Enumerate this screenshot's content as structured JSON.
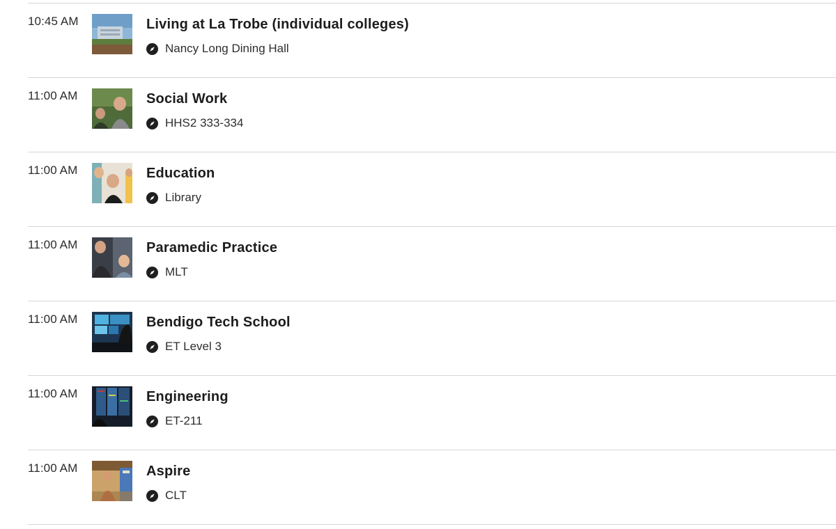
{
  "events": [
    {
      "time": "10:45 AM",
      "title": "Living at La Trobe (individual colleges)",
      "location": "Nancy Long Dining Hall",
      "image": "campus-building-photo"
    },
    {
      "time": "11:00 AM",
      "title": "Social Work",
      "location": "HHS2 333-334",
      "image": "students-outdoors-photo"
    },
    {
      "time": "11:00 AM",
      "title": "Education",
      "location": "Library",
      "image": "students-smiling-photo"
    },
    {
      "time": "11:00 AM",
      "title": "Paramedic Practice",
      "location": "MLT",
      "image": "paramedic-students-photo"
    },
    {
      "time": "11:00 AM",
      "title": "Bendigo Tech School",
      "location": "ET Level 3",
      "image": "tech-screens-photo"
    },
    {
      "time": "11:00 AM",
      "title": "Engineering",
      "location": "ET-211",
      "image": "engineering-lab-photo"
    },
    {
      "time": "11:00 AM",
      "title": "Aspire",
      "location": "CLT",
      "image": "aspire-student-photo"
    }
  ],
  "icons": {
    "location": "compass-icon"
  },
  "colors": {
    "divider": "#d6d6d6",
    "text": "#1f1f1f",
    "icon": "#1f1f1f"
  }
}
